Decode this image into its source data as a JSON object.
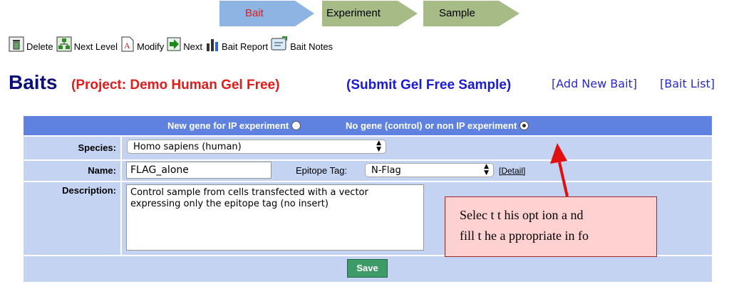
{
  "workflow": {
    "steps": [
      {
        "label": "Bait",
        "color": "#8db4e2",
        "text_color": "#e21b1b"
      },
      {
        "label": "Experiment",
        "color": "#a6bb85",
        "text_color": "#000000"
      },
      {
        "label": "Sample",
        "color": "#a6bb85",
        "text_color": "#000000"
      }
    ]
  },
  "toolbar": {
    "items": [
      {
        "label": "Delete",
        "icon": "trash-icon"
      },
      {
        "label": "Next Level",
        "icon": "hierarchy-icon"
      },
      {
        "label": "Modify",
        "icon": "edit-document-icon"
      },
      {
        "label": "Next",
        "icon": "arrow-right-icon"
      },
      {
        "label": "Bait Report",
        "icon": "bar-chart-icon"
      },
      {
        "label": "Bait Notes",
        "icon": "notes-icon"
      }
    ]
  },
  "header": {
    "title": "Baits",
    "project": "(Project: Demo Human Gel Free)",
    "submit_link": "(Submit Gel Free Sample)",
    "add_link": "[Add New Bait]",
    "list_link": "[Bait List]"
  },
  "form": {
    "radio_new_gene": "New gene for IP experiment",
    "radio_no_gene": "No gene (control) or non IP experiment",
    "radio_selected": "no_gene",
    "species_label": "Species:",
    "species_value": "Homo sapiens (human)",
    "name_label": "Name:",
    "name_value": "FLAG_alone",
    "epitope_label": "Epitope Tag:",
    "epitope_value": "N-Flag",
    "detail_link": "[Detail]",
    "description_label": "Description:",
    "description_value": "Control sample from cells transfected with a vector\nexpressing only the epitope tag (no insert)",
    "save_label": "Save"
  },
  "annotation": {
    "line1": "Selec t t his  opt ion a  nd",
    "line2": "fill t he  a ppropriate  in fo"
  },
  "colors": {
    "panel_header": "#5f82e1",
    "panel_body": "#c5d3f2",
    "title_blue": "#0a0f7a",
    "project_red": "#e21b1b",
    "save_green": "#3e9a67"
  }
}
